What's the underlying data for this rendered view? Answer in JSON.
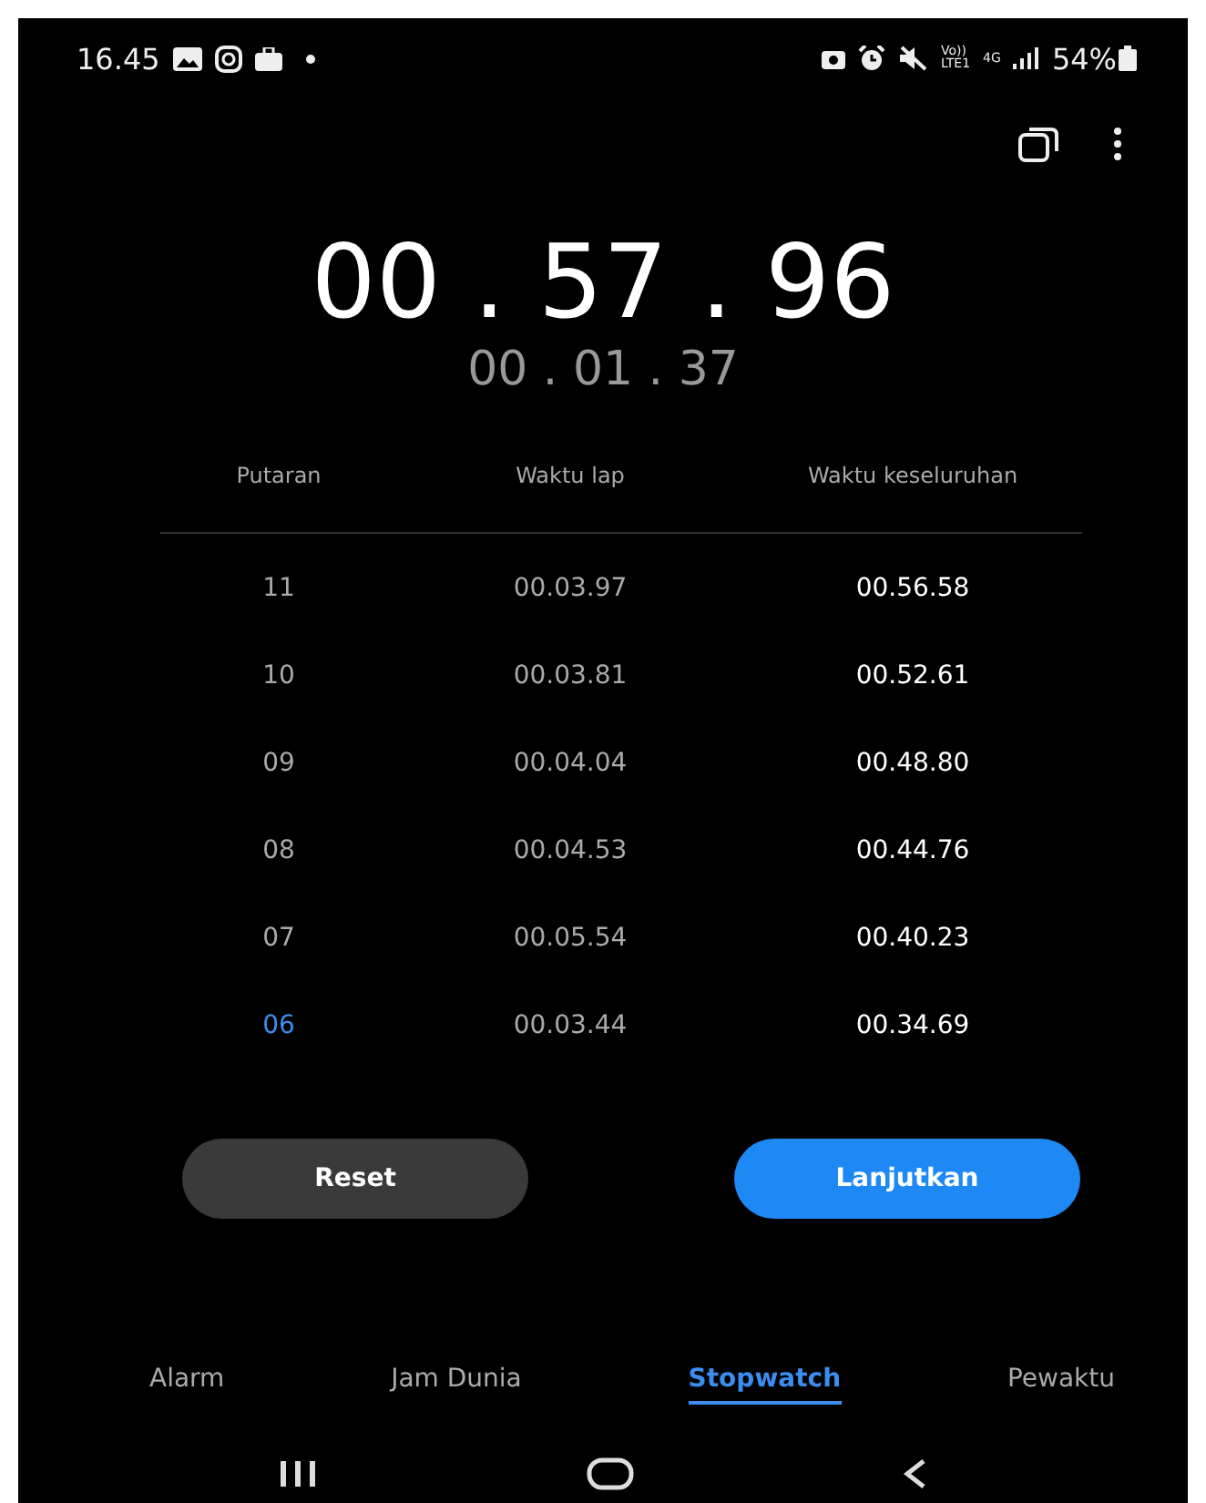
{
  "status_bar": {
    "time": "16.45",
    "volte": "Vo))",
    "lte": "LTE1",
    "network": "4G",
    "battery": "54%"
  },
  "stopwatch": {
    "total": "00 . 57 . 96",
    "lap": "00 . 01 . 37"
  },
  "laps": {
    "columns": [
      "Putaran",
      "Waktu lap",
      "Waktu keseluruhan"
    ],
    "rows": [
      {
        "lap": "11",
        "lap_time": "00.03.97",
        "total_time": "00.56.58",
        "highlighted": false
      },
      {
        "lap": "10",
        "lap_time": "00.03.81",
        "total_time": "00.52.61",
        "highlighted": false
      },
      {
        "lap": "09",
        "lap_time": "00.04.04",
        "total_time": "00.48.80",
        "highlighted": false
      },
      {
        "lap": "08",
        "lap_time": "00.04.53",
        "total_time": "00.44.76",
        "highlighted": false
      },
      {
        "lap": "07",
        "lap_time": "00.05.54",
        "total_time": "00.40.23",
        "highlighted": false
      },
      {
        "lap": "06",
        "lap_time": "00.03.44",
        "total_time": "00.34.69",
        "highlighted": true
      }
    ]
  },
  "buttons": [
    {
      "label": "Reset",
      "kind": "secondary"
    },
    {
      "label": "Lanjutkan",
      "kind": "primary"
    }
  ],
  "tabs": [
    {
      "label": "Alarm",
      "selected": false
    },
    {
      "label": "Jam Dunia",
      "selected": false
    },
    {
      "label": "Stopwatch",
      "selected": true
    },
    {
      "label": "Pewaktu",
      "selected": false
    }
  ]
}
